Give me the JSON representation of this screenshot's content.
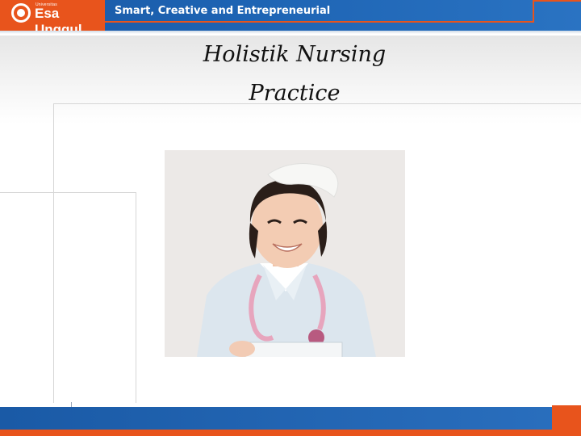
{
  "header": {
    "logo_small_text": "Universitas",
    "logo_text": "Esa Unggul",
    "tagline": "Smart, Creative and Entrepreneurial"
  },
  "slide": {
    "title_line1": "Holistik Nursing",
    "title_line2": "Practice"
  },
  "colors": {
    "brand_blue": "#1d63b3",
    "brand_orange": "#e8541c"
  },
  "photo": {
    "icon": "nurse-photo"
  }
}
